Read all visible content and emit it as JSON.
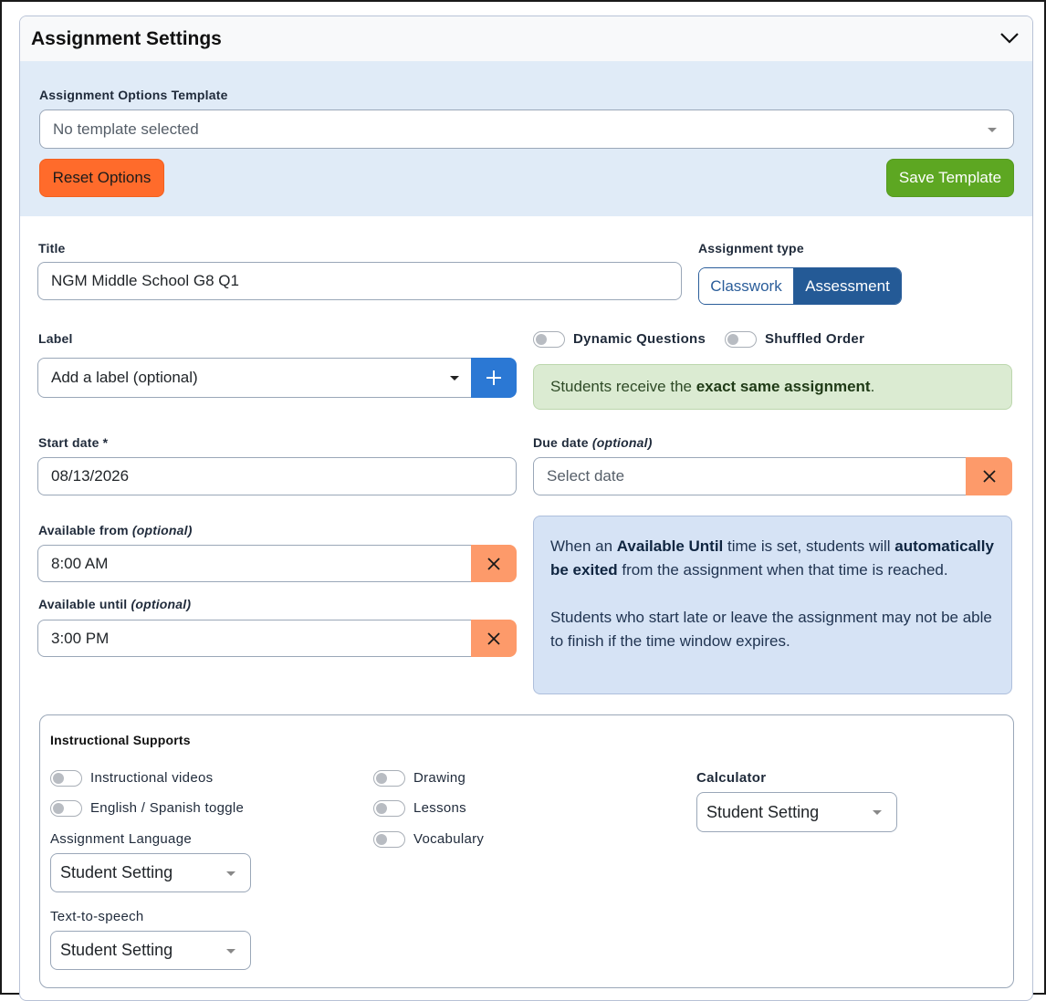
{
  "card": {
    "title": "Assignment Settings"
  },
  "template": {
    "label": "Assignment Options Template",
    "value": "No template selected",
    "reset_label": "Reset Options",
    "save_label": "Save Template"
  },
  "title_field": {
    "label": "Title",
    "value": "NGM Middle School G8 Q1"
  },
  "assignment_type": {
    "label": "Assignment type",
    "options": [
      "Classwork",
      "Assessment"
    ],
    "selected": "Assessment"
  },
  "label_field": {
    "label": "Label",
    "placeholder": "Add a label (optional)",
    "add_symbol": "+"
  },
  "toggles": {
    "dynamic_questions": "Dynamic Questions",
    "shuffled_order": "Shuffled Order"
  },
  "same_assignment_alert": {
    "prefix": "Students receive the ",
    "bold": "exact same assignment",
    "suffix": "."
  },
  "start_date": {
    "label": "Start date *",
    "value": "08/13/2026"
  },
  "due_date": {
    "label": "Due date",
    "label_optional": "(optional)",
    "placeholder": "Select date"
  },
  "available_from": {
    "label": "Available from",
    "label_optional": "(optional)",
    "value": "8:00 AM"
  },
  "available_until": {
    "label": "Available until",
    "label_optional": "(optional)",
    "value": "3:00 PM"
  },
  "time_alert": {
    "p1_a": "When an ",
    "p1_b": "Available Until",
    "p1_c": " time is set, students will ",
    "p1_d": "automatically be exited",
    "p1_e": " from the assignment when that time is reached.",
    "p2": "Students who start late or leave the assignment may not be able to finish if the time window expires."
  },
  "supports": {
    "title": "Instructional Supports",
    "instructional_videos": "Instructional videos",
    "english_spanish": "English / Spanish toggle",
    "drawing": "Drawing",
    "lessons": "Lessons",
    "vocabulary": "Vocabulary",
    "assignment_language_label": "Assignment Language",
    "assignment_language_value": "Student Setting",
    "tts_label": "Text-to-speech",
    "tts_value": "Student Setting",
    "calculator_label": "Calculator",
    "calculator_value": "Student Setting"
  },
  "colors": {
    "reset": "#ff6b2b",
    "save": "#5da722",
    "primary": "#245a96",
    "add": "#2b78d4",
    "clear": "#fd9a6a"
  }
}
